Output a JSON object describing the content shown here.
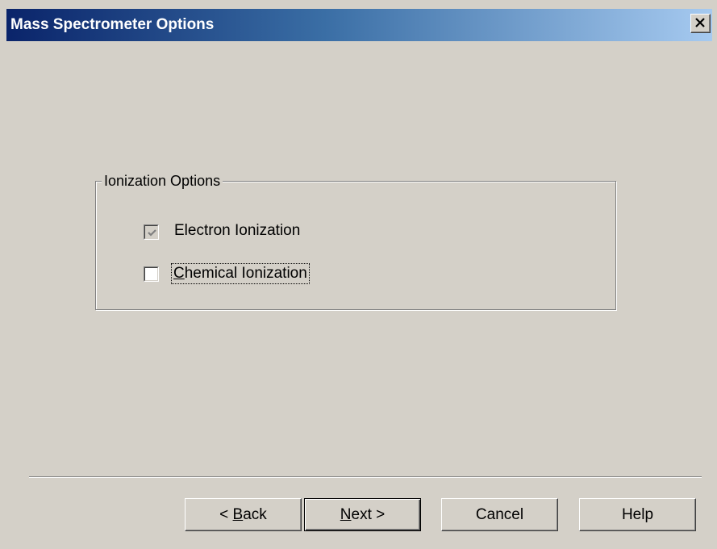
{
  "window": {
    "title": "Mass Spectrometer Options",
    "close_icon": "close-icon"
  },
  "ionization_group": {
    "label": "Ionization Options",
    "options": [
      {
        "label": "Electron Ionization",
        "checked": true,
        "enabled": false
      },
      {
        "label": "Chemical Ionization",
        "checked": false,
        "enabled": true,
        "focused": true
      }
    ]
  },
  "buttons": {
    "back": {
      "prefix": "< ",
      "mnemonic": "B",
      "rest": "ack"
    },
    "next": {
      "mnemonic": "N",
      "rest": "ext >"
    },
    "cancel": "Cancel",
    "help": "Help"
  },
  "colors": {
    "dialog_face": "#d4d0c8",
    "title_start": "#0a246a",
    "title_end": "#a6caf0"
  }
}
